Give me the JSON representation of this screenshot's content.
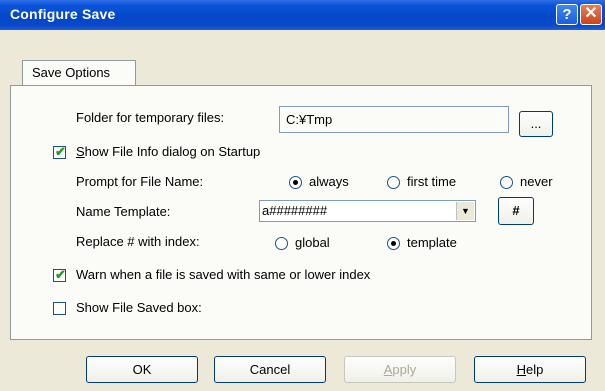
{
  "window": {
    "title": "Configure Save"
  },
  "titlebar": {
    "help_glyph": "?",
    "close_glyph": "✕"
  },
  "tabs": [
    {
      "label": "Save Options"
    }
  ],
  "temp_folder": {
    "label": "Folder for temporary files:",
    "value": "C:¥Tmp",
    "browse_label": "..."
  },
  "show_file_info": {
    "label_first": "S",
    "label_rest": "how File Info dialog on Startup",
    "checked": true
  },
  "prompt": {
    "label": "Prompt for File Name:",
    "options": [
      "always",
      "first time",
      "never"
    ],
    "selected": "always"
  },
  "name_template": {
    "label": "Name Template:",
    "value": "a########",
    "hash_label": "#"
  },
  "replace": {
    "label": "Replace # with index:",
    "options": [
      "global",
      "template"
    ],
    "selected": "template"
  },
  "warn": {
    "label": "Warn when a file is saved with same or lower index",
    "checked": true
  },
  "show_saved": {
    "label": "Show File Saved box:",
    "checked": false
  },
  "footer": {
    "ok_label": "OK",
    "cancel_label": "Cancel",
    "apply_first": "A",
    "apply_rest": "pply",
    "help_first": "H",
    "help_rest": "elp"
  }
}
